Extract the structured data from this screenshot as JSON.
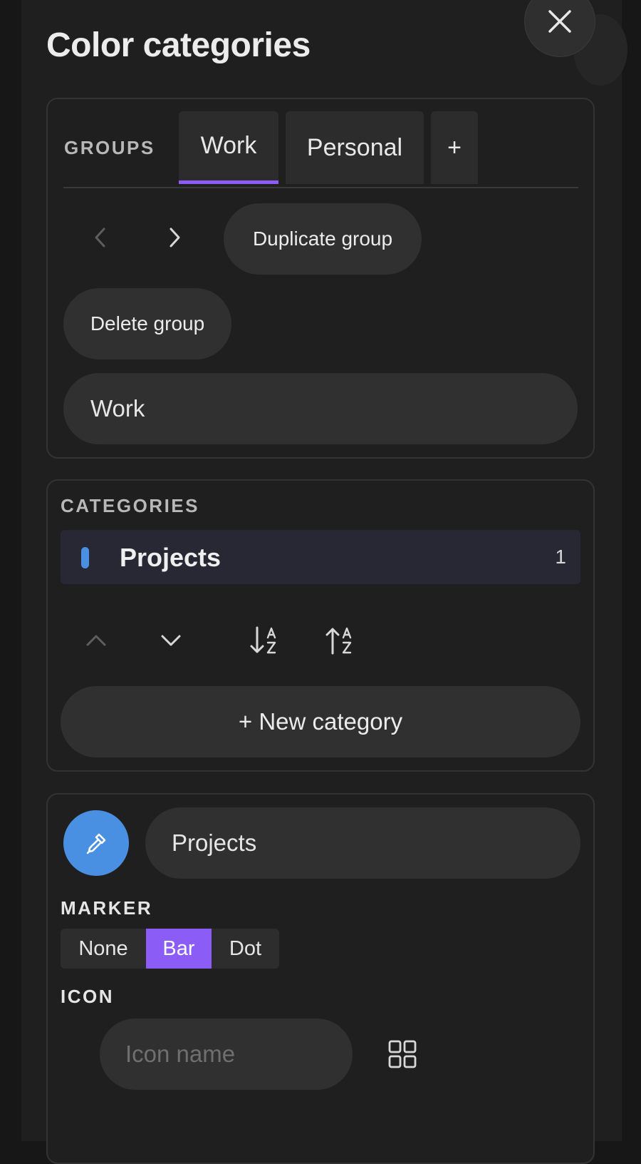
{
  "title": "Color categories",
  "close": {
    "icon": "close-icon"
  },
  "groups": {
    "label": "GROUPS",
    "tabs": [
      {
        "label": "Work",
        "active": true
      },
      {
        "label": "Personal",
        "active": false
      }
    ],
    "add_label": "+",
    "duplicate_label": "Duplicate group",
    "delete_label": "Delete group",
    "name_value": "Work"
  },
  "categories": {
    "label": "CATEGORIES",
    "items": [
      {
        "name": "Projects",
        "count": "1",
        "color": "#4a90e2"
      }
    ],
    "new_label": "+ New category"
  },
  "editor": {
    "color": "#4a90e2",
    "name_value": "Projects",
    "marker_label": "MARKER",
    "marker_options": [
      "None",
      "Bar",
      "Dot"
    ],
    "marker_selected": "Bar",
    "icon_label": "ICON",
    "icon_placeholder": "Icon name"
  },
  "accent": "#8b5cf6"
}
